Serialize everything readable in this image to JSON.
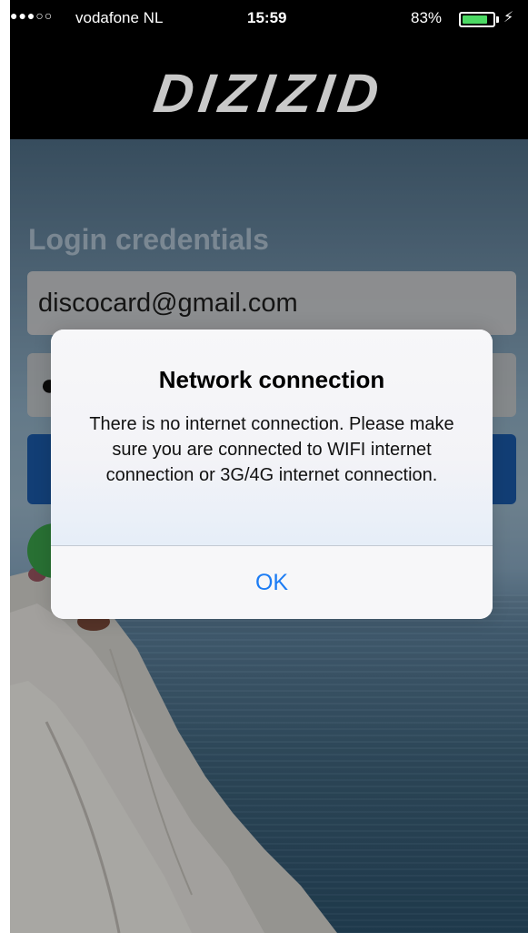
{
  "status_bar": {
    "signal_dots": "●●●○○",
    "carrier": "vodafone NL",
    "time": "15:59",
    "battery_percent": "83%",
    "battery_level": 0.83,
    "charging_icon": "lightning-icon"
  },
  "header": {
    "logo_text": "DIZIZID"
  },
  "login": {
    "title": "Login credentials",
    "email_value": "discocard@gmail.com",
    "password_value": "●"
  },
  "alert": {
    "title": "Network connection",
    "message": "There is no internet connection. Please make sure you are connected to WIFI internet connection or 3G/4G internet connection.",
    "ok_label": "OK"
  },
  "colors": {
    "header_bg": "#000000",
    "login_button": "#1a5aa8",
    "ok_text": "#1c7cf4",
    "battery_fill": "#4cd964"
  }
}
